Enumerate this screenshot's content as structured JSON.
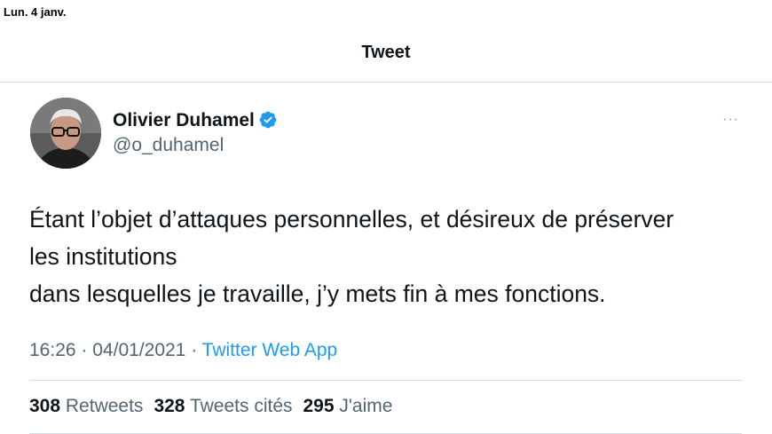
{
  "status_bar": {
    "date": "Lun. 4 janv."
  },
  "nav": {
    "title": "Tweet"
  },
  "tweet": {
    "author_name": "Olivier Duhamel",
    "author_handle": "@o_duhamel",
    "verified": true,
    "lines": [
      "Étant l’objet d’attaques personnelles, et désireux de préserver",
      "les institutions",
      "dans lesquelles je travaille, j’y mets fin à mes fonctions."
    ],
    "time": "16:26",
    "date": "04/01/2021",
    "separator": "·",
    "source": "Twitter Web App",
    "more_icon": "···"
  },
  "stats": {
    "retweets_count": "308",
    "retweets_label": "Retweets",
    "quotes_count": "328",
    "quotes_label": "Tweets cités",
    "likes_count": "295",
    "likes_label": "J'aime"
  },
  "colors": {
    "accent": "#1d9bf0",
    "text": "#0f1419",
    "secondary": "#536471"
  }
}
